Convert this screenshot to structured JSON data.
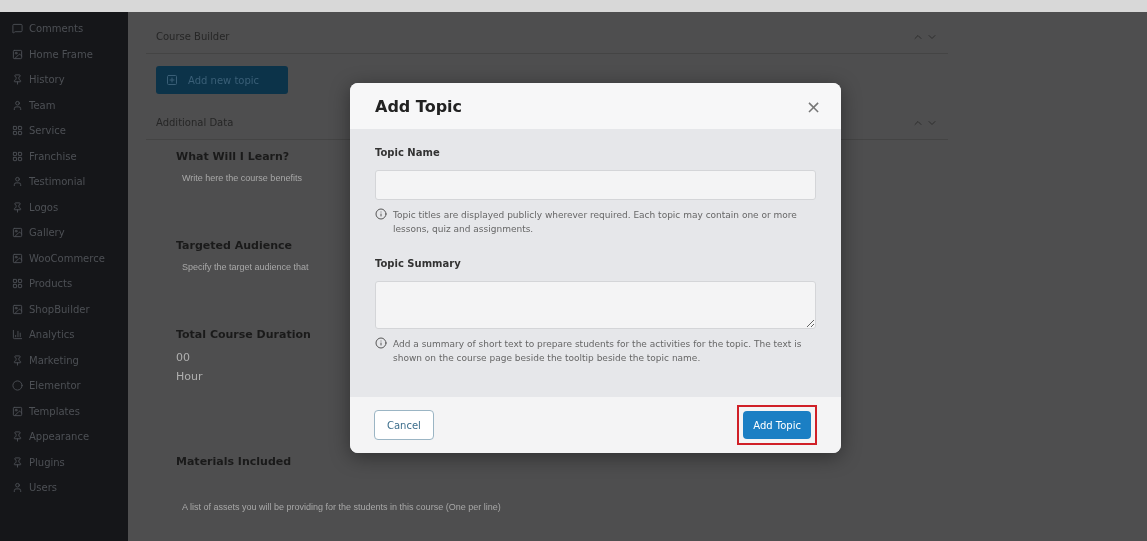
{
  "sidebar": {
    "items": [
      {
        "label": "Comments"
      },
      {
        "label": "Home Frame"
      },
      {
        "label": "History"
      },
      {
        "label": "Team"
      },
      {
        "label": "Service"
      },
      {
        "label": "Franchise"
      },
      {
        "label": "Testimonial"
      },
      {
        "label": "Logos"
      },
      {
        "label": "Gallery"
      },
      {
        "label": "WooCommerce"
      },
      {
        "label": "Products"
      },
      {
        "label": "ShopBuilder"
      },
      {
        "label": "Analytics"
      },
      {
        "label": "Marketing"
      },
      {
        "label": "Elementor"
      },
      {
        "label": "Templates"
      },
      {
        "label": "Appearance"
      },
      {
        "label": "Plugins"
      },
      {
        "label": "Users"
      }
    ]
  },
  "course_builder": {
    "title": "Course Builder",
    "button": "Add new topic"
  },
  "additional_data": {
    "title": "Additional Data",
    "fields": [
      {
        "label": "What Will I Learn?",
        "placeholder": "Write here the course benefits"
      },
      {
        "label": "Targeted Audience",
        "placeholder": "Specify the target audience that"
      }
    ],
    "duration": {
      "label": "Total Course Duration",
      "value": "00",
      "unit": "Hour"
    },
    "materials": {
      "label": "Materials Included",
      "placeholder": "A list of assets you will be providing for the students in this course (One per line)"
    }
  },
  "dialog": {
    "title": "Add Topic",
    "close": "×",
    "fields": [
      {
        "kind": "input",
        "label": "Topic Name",
        "hint": "Topic titles are displayed publicly wherever required. Each topic may contain one or more lessons, quiz and assignments."
      },
      {
        "kind": "textarea",
        "label": "Topic Summary",
        "hint": "Add a summary of short text to prepare students for the activities for the topic. The text is shown on the course page beside the tooltip beside the topic name."
      }
    ],
    "cancel": "Cancel",
    "submit": "Add Topic",
    "submit_highlighted": true
  }
}
